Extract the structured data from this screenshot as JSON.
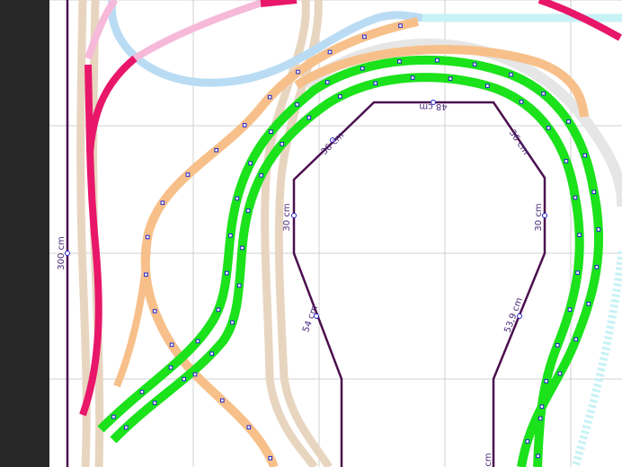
{
  "dimensions": {
    "width_label": "300 cm",
    "top_label": "48 cm",
    "left_diag_top": "36 cm",
    "right_diag_top": "36 cm",
    "left_side": "30 cm",
    "right_side": "30 cm",
    "left_diag_bottom": "54 cm",
    "right_diag_bottom": "53,9 cm",
    "bottom_label": "cm"
  },
  "colors": {
    "background": "#ffffff",
    "grid": "#d0d0d0",
    "outline": "#4b0f4f",
    "track_green": "#1be21b",
    "track_orange": "#f7c08a",
    "track_magenta": "#e8176a",
    "track_pink": "#f6b9d9",
    "track_blue": "#b9dcf4",
    "track_cyan": "#c7f2f6",
    "track_tan": "#e8d5c0",
    "node_marker": "#2222cc"
  }
}
